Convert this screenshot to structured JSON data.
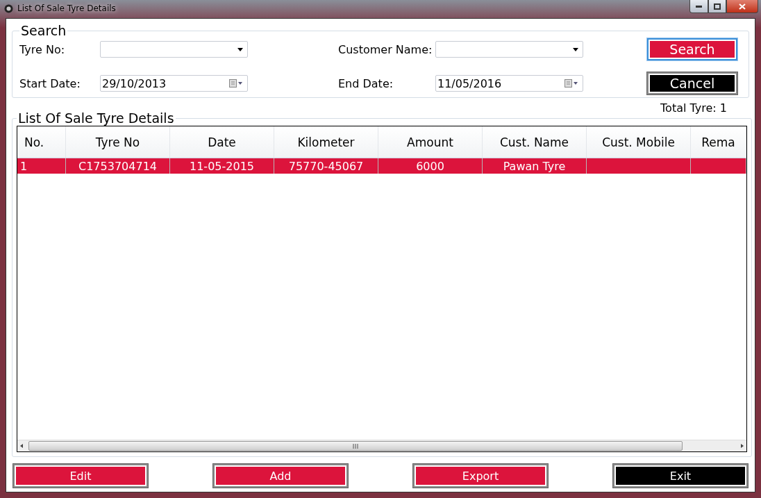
{
  "window": {
    "title": "List Of Sale Tyre Details"
  },
  "search": {
    "title": "Search",
    "fields": [
      {
        "label": "Tyre No:",
        "kind": "dropdown"
      },
      {
        "label": "Customer Name:",
        "kind": "dropdown"
      },
      {
        "label": "Start Date:",
        "kind": "date",
        "value": "29/10/2013"
      },
      {
        "label": "End Date:",
        "kind": "date",
        "value": "11/05/2016"
      }
    ],
    "buttons": [
      {
        "label": "Search",
        "kind": "primary",
        "focused": true
      },
      {
        "label": "Cancel",
        "kind": "dark",
        "focused": false
      }
    ]
  },
  "total": "Total Tyre:  1",
  "list": {
    "title": "List Of Sale Tyre Details",
    "columns": [
      "No.",
      "Tyre No",
      "Date",
      "Kilometer",
      "Amount",
      "Cust. Name",
      "Cust. Mobile",
      "Rema"
    ],
    "rows": [
      {
        "selected": true,
        "cells": [
          "1",
          "C1753704714",
          "11-05-2015",
          "75770-45067",
          "6000",
          "Pawan Tyre"
        ]
      }
    ]
  },
  "buttons": [
    {
      "label": "Edit",
      "kind": "primary"
    },
    {
      "label": "Add",
      "kind": "primary"
    },
    {
      "label": "Export",
      "kind": "primary"
    },
    {
      "label": "Exit",
      "kind": "dark"
    }
  ]
}
